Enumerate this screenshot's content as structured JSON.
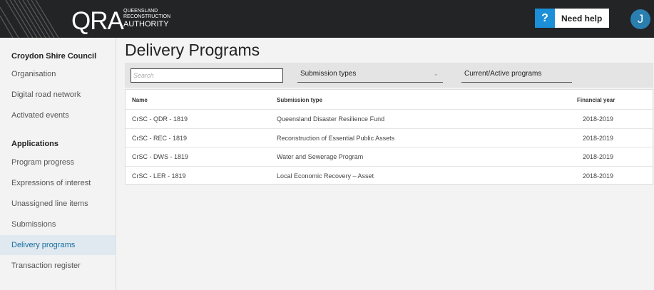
{
  "header": {
    "logo_main": "QRA",
    "logo_line1": "QUEENSLAND",
    "logo_line2": "RECONSTRUCTION",
    "logo_line3": "AUTHORITY",
    "help_icon": "?",
    "help_label": "Need help",
    "avatar_initial": "J",
    "colors": {
      "topbar": "#222426",
      "accent": "#1b8fd8",
      "avatar": "#2a7fb0"
    }
  },
  "sidebar": {
    "section1_title": "Croydon Shire Council",
    "section1_items": [
      "Organisation",
      "Digital road network",
      "Activated events"
    ],
    "section2_title": "Applications",
    "section2_items": [
      "Program progress",
      "Expressions of interest",
      "Unassigned line items",
      "Submissions",
      "Delivery programs",
      "Transaction register"
    ],
    "active_item": "Delivery programs"
  },
  "main": {
    "title": "Delivery Programs",
    "search_placeholder": "Search",
    "filter_submission_types": "Submission types",
    "filter_programs": "Current/Active programs",
    "table": {
      "headers": [
        "Name",
        "Submission type",
        "Financial year"
      ],
      "rows": [
        [
          "CrSC - QDR - 1819",
          "Queensland Disaster Resilience Fund",
          "2018-2019"
        ],
        [
          "CrSC - REC - 1819",
          "Reconstruction of Essential Public Assets",
          "2018-2019"
        ],
        [
          "CrSC - DWS - 1819",
          "Water and Sewerage Program",
          "2018-2019"
        ],
        [
          "CrSC - LER - 1819",
          "Local Economic Recovery – Asset",
          "2018-2019"
        ]
      ]
    }
  }
}
